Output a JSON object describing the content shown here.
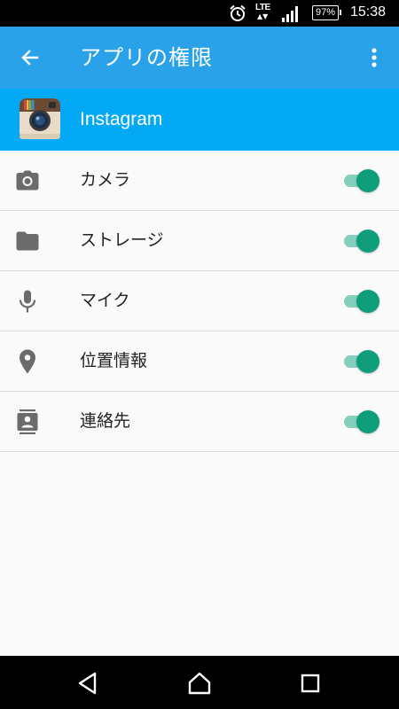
{
  "status_bar": {
    "network": "LTE",
    "battery": "97%",
    "time": "15:38"
  },
  "app_bar": {
    "title": "アプリの権限"
  },
  "app": {
    "name": "Instagram"
  },
  "permissions": [
    {
      "label": "カメラ",
      "icon": "camera-icon",
      "enabled": true
    },
    {
      "label": "ストレージ",
      "icon": "folder-icon",
      "enabled": true
    },
    {
      "label": "マイク",
      "icon": "microphone-icon",
      "enabled": true
    },
    {
      "label": "位置情報",
      "icon": "location-pin-icon",
      "enabled": true
    },
    {
      "label": "連絡先",
      "icon": "contacts-icon",
      "enabled": true
    }
  ],
  "colors": {
    "app_bar": "#2aa2e9",
    "app_header": "#03a9f4",
    "toggle_thumb": "#0f9d7a",
    "toggle_track": "#84cfbd",
    "icon_gray": "#6b6b6b",
    "divider": "#dcdcdc"
  }
}
